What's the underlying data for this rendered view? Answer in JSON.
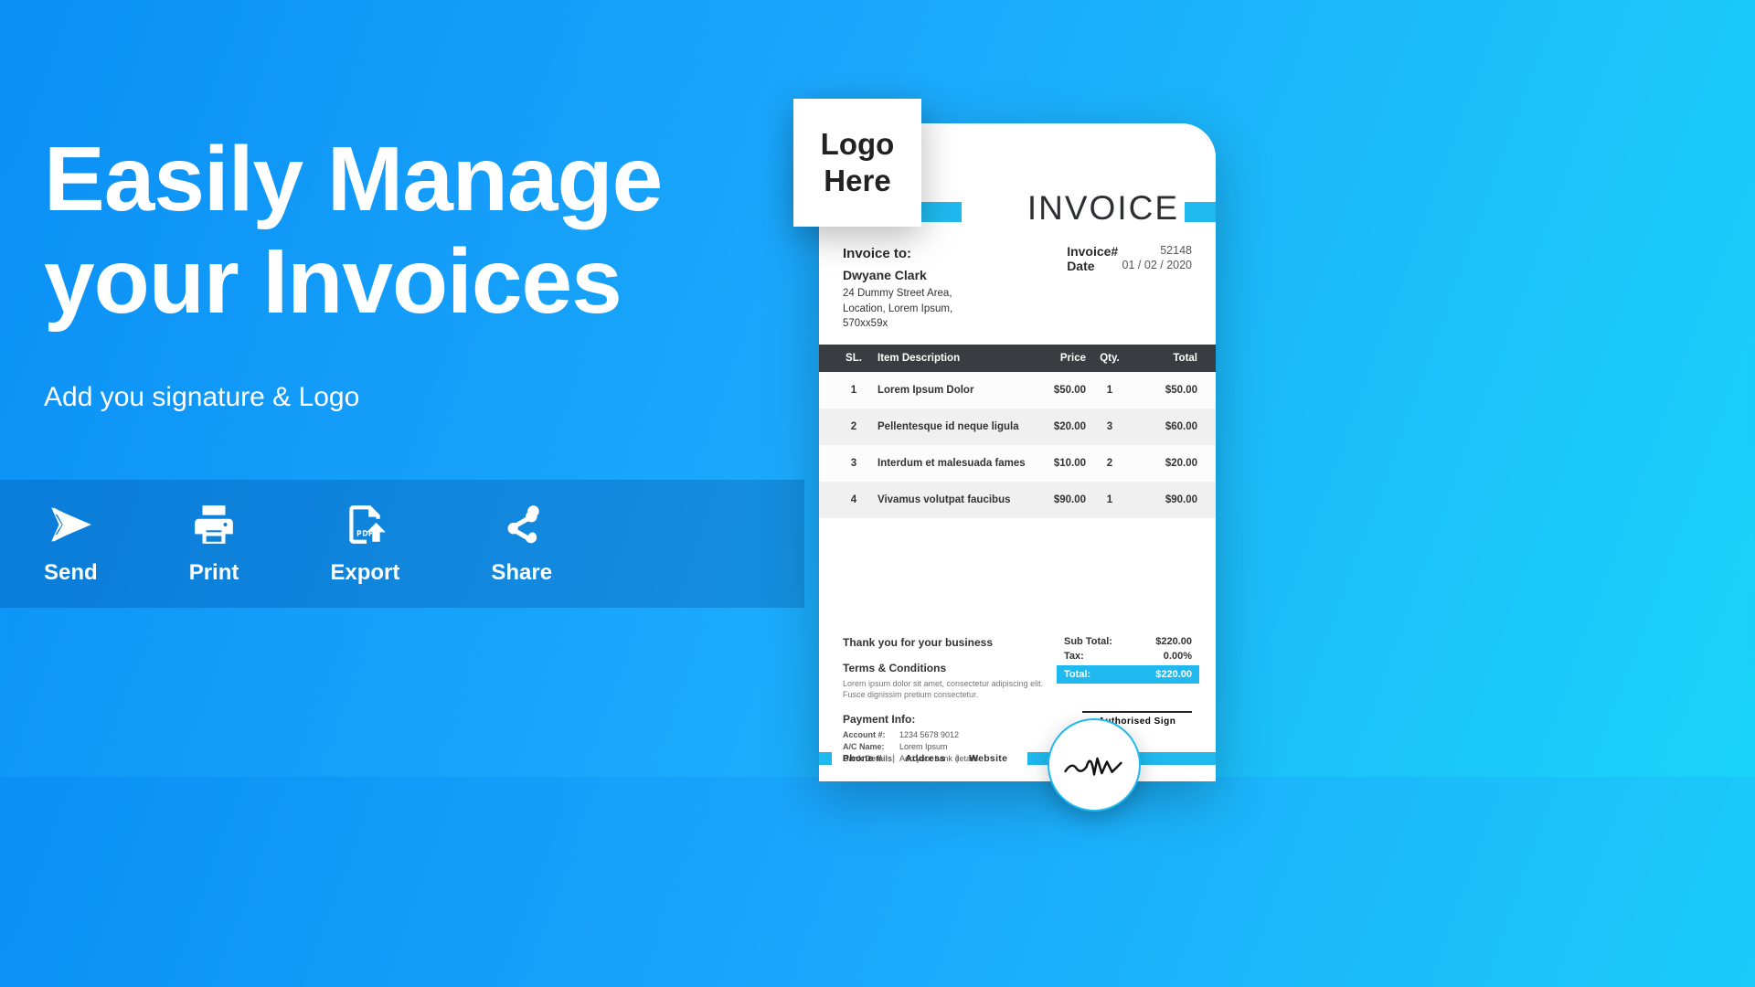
{
  "headline_line1": "Easily Manage",
  "headline_line2": "your Invoices",
  "subtitle": "Add you signature & Logo",
  "actions": {
    "send": "Send",
    "print": "Print",
    "export": "Export",
    "share": "Share"
  },
  "logo_box_line1": "Logo",
  "logo_box_line2": "Here",
  "invoice": {
    "title": "INVOICE",
    "to_label": "Invoice to:",
    "to_name": "Dwyane Clark",
    "to_addr1": "24 Dummy Street Area,",
    "to_addr2": "Location, Lorem Ipsum,",
    "to_addr3": "570xx59x",
    "number_label": "Invoice#",
    "number": "52148",
    "date_label": "Date",
    "date": "01 / 02 / 2020",
    "columns": {
      "sl": "SL.",
      "desc": "Item Description",
      "price": "Price",
      "qty": "Qty.",
      "total": "Total"
    },
    "items": [
      {
        "sl": "1",
        "desc": "Lorem Ipsum Dolor",
        "price": "$50.00",
        "qty": "1",
        "total": "$50.00"
      },
      {
        "sl": "2",
        "desc": "Pellentesque id neque ligula",
        "price": "$20.00",
        "qty": "3",
        "total": "$60.00"
      },
      {
        "sl": "3",
        "desc": "Interdum et malesuada fames",
        "price": "$10.00",
        "qty": "2",
        "total": "$20.00"
      },
      {
        "sl": "4",
        "desc": "Vivamus volutpat faucibus",
        "price": "$90.00",
        "qty": "1",
        "total": "$90.00"
      }
    ],
    "thanks": "Thank you for your business",
    "terms_label": "Terms & Conditions",
    "terms_text": "Lorem ipsum dolor sit amet, consectetur adipiscing elit. Fusce dignissim pretium consectetur.",
    "payment_label": "Payment Info:",
    "payment_account_k": "Account #:",
    "payment_account_v": "1234 5678 9012",
    "payment_name_k": "A/C Name:",
    "payment_name_v": "Lorem Ipsum",
    "payment_bank_k": "Bank Details:",
    "payment_bank_v": "Add your bank details",
    "subtotal_label": "Sub Total:",
    "subtotal": "$220.00",
    "tax_label": "Tax:",
    "tax": "0.00%",
    "total_label": "Total:",
    "total": "$220.00",
    "auth_sign": "Authorised Sign",
    "footer_phone": "Phone #",
    "footer_address": "Address",
    "footer_website": "Website"
  }
}
